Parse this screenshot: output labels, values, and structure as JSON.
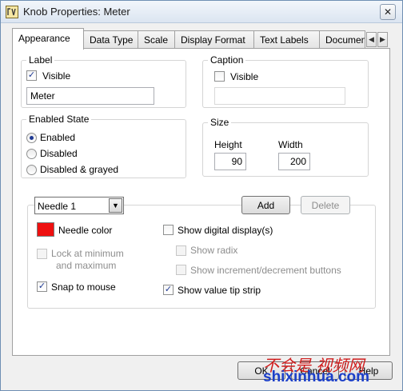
{
  "window": {
    "title": "Knob Properties: Meter",
    "close_glyph": "✕"
  },
  "tabs": [
    {
      "label": "Appearance",
      "active": true
    },
    {
      "label": "Data Type"
    },
    {
      "label": "Scale"
    },
    {
      "label": "Display Format"
    },
    {
      "label": "Text Labels"
    },
    {
      "label": "Documen"
    }
  ],
  "tab_scroll": {
    "left": "◀",
    "right": "▶"
  },
  "label_group": {
    "legend": "Label",
    "visible_label": "Visible",
    "visible_checked": true,
    "value": "Meter"
  },
  "caption_group": {
    "legend": "Caption",
    "visible_label": "Visible",
    "visible_checked": false,
    "value": ""
  },
  "enabled_state": {
    "legend": "Enabled State",
    "options": [
      "Enabled",
      "Disabled",
      "Disabled & grayed"
    ],
    "selected": "Enabled"
  },
  "size_group": {
    "legend": "Size",
    "height_label": "Height",
    "height_value": "90",
    "width_label": "Width",
    "width_value": "200"
  },
  "needle": {
    "selected": "Needle 1",
    "add_label": "Add",
    "delete_label": "Delete",
    "color_label": "Needle color",
    "color": "#ee1010",
    "lock_label_line1": "Lock at minimum",
    "lock_label_line2": "and maximum",
    "snap_label": "Snap to mouse",
    "snap_checked": true,
    "show_digital_label": "Show digital display(s)",
    "show_radix_label": "Show radix",
    "show_incdec_label": "Show increment/decrement buttons",
    "show_tip_label": "Show value tip strip",
    "show_tip_checked": true
  },
  "footer": {
    "ok_label": "OK",
    "cancel_label": "Cancel",
    "help_label": "Help"
  },
  "watermark": {
    "chinese": "不会是 视频网",
    "url": "shixinhua.com"
  },
  "icons": {
    "check": "✓",
    "dropdown_arrow": "▼"
  }
}
